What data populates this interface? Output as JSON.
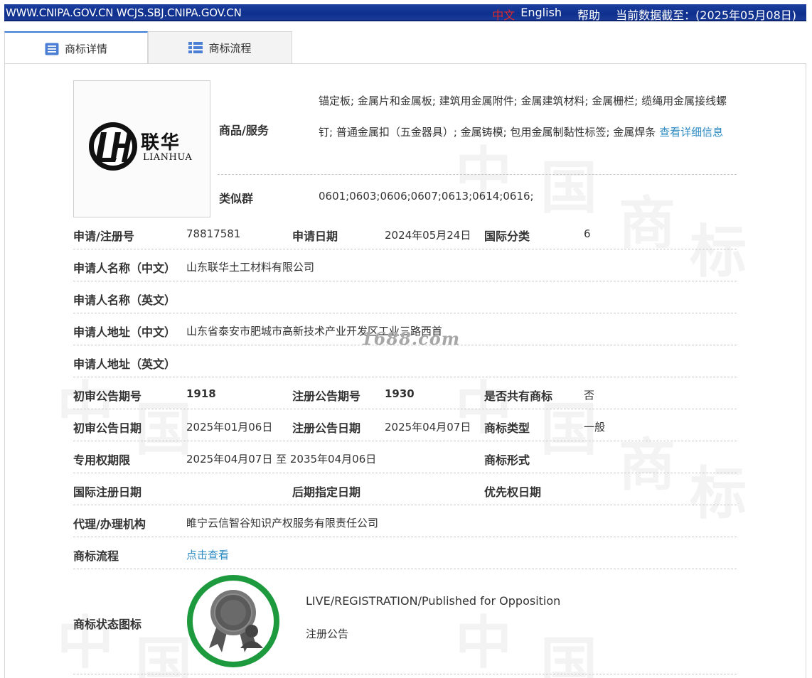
{
  "topbar": {
    "sites": "WWW.CNIPA.GOV.CN WCJS.SBJ.CNIPA.GOV.CN",
    "lang_zh": "中文",
    "lang_en": "English",
    "help": "帮助",
    "data_date": "当前数据截至：(2025年05月08日)"
  },
  "tabs": [
    {
      "label": "商标详情",
      "icon": "list-icon"
    },
    {
      "label": "商标流程",
      "icon": "table-icon"
    }
  ],
  "logo": {
    "brand_cn": "联华",
    "brand_en": "LIANHUA"
  },
  "goods": {
    "label": "商品/服务",
    "text": "锚定板; 金属片和金属板; 建筑用金属附件; 金属建筑材料; 金属栅栏; 缆绳用金属接线螺钉; 普通金属扣（五金器具）; 金属铸模; 包用金属制黏性标签; 金属焊条 ",
    "more_link": "查看详细信息"
  },
  "similar": {
    "label": "类似群",
    "value": "0601;0603;0606;0607;0613;0614;0616;"
  },
  "rows": {
    "reg_no": {
      "label": "申请/注册号",
      "value": "78817581"
    },
    "app_date": {
      "label": "申请日期",
      "value": "2024年05月24日"
    },
    "intl_class": {
      "label": "国际分类",
      "value": "6"
    },
    "name_cn": {
      "label": "申请人名称（中文）",
      "value": "山东联华土工材料有限公司"
    },
    "name_en": {
      "label": "申请人名称（英文）",
      "value": ""
    },
    "addr_cn": {
      "label": "申请人地址（中文）",
      "value": "山东省泰安市肥城市高新技术产业开发区工业三路西首"
    },
    "addr_en": {
      "label": "申请人地址（英文）",
      "value": ""
    },
    "prelim_no": {
      "label": "初审公告期号",
      "value": "1918"
    },
    "reg_pub_no": {
      "label": "注册公告期号",
      "value": "1930"
    },
    "shared": {
      "label": "是否共有商标",
      "value": "否"
    },
    "prelim_date": {
      "label": "初审公告日期",
      "value": "2025年01月06日"
    },
    "reg_pub_date": {
      "label": "注册公告日期",
      "value": "2025年04月07日"
    },
    "tm_type": {
      "label": "商标类型",
      "value": "一般"
    },
    "excl_period": {
      "label": "专用权期限",
      "value": "2025年04月07日 至 2035年04月06日"
    },
    "tm_form": {
      "label": "商标形式",
      "value": ""
    },
    "intl_reg_date": {
      "label": "国际注册日期",
      "value": ""
    },
    "later_date": {
      "label": "后期指定日期",
      "value": ""
    },
    "priority_date": {
      "label": "优先权日期",
      "value": ""
    },
    "agent": {
      "label": "代理/办理机构",
      "value": "睢宁云信智谷知识产权服务有限责任公司"
    },
    "flow": {
      "label": "商标流程",
      "link": "点击查看"
    },
    "status_icon": {
      "label": "商标状态图标",
      "status_en": "LIVE/REGISTRATION/Published for Opposition",
      "status_cn": "注册公告"
    }
  },
  "watermark": "1688.com",
  "colors": {
    "topbar": "#0e2f8c",
    "link": "#2d8bc4",
    "badge_green": "#1e9a3e"
  }
}
